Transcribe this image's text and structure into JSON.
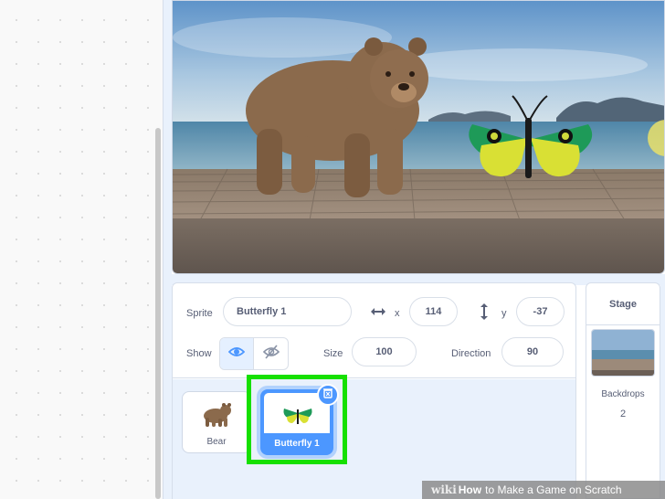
{
  "sprite_info": {
    "sprite_label": "Sprite",
    "sprite_name": "Butterfly 1",
    "x_label": "x",
    "x_value": "114",
    "y_label": "y",
    "y_value": "-37",
    "show_label": "Show",
    "size_label": "Size",
    "size_value": "100",
    "direction_label": "Direction",
    "direction_value": "90"
  },
  "sprites": [
    {
      "name": "Bear",
      "icon": "bear-icon",
      "selected": false
    },
    {
      "name": "Butterfly 1",
      "icon": "butterfly-icon",
      "selected": true
    }
  ],
  "stage_panel": {
    "title": "Stage",
    "backdrops_label": "Backdrops",
    "backdrops_count": "2"
  },
  "watermark": {
    "wiki": "wiki",
    "how": "How",
    "rest": "to Make a Game on Scratch"
  },
  "colors": {
    "accent": "#4c97ff",
    "highlight": "#16e000",
    "text": "#575e75",
    "panel_bg": "#e9f1fc"
  }
}
